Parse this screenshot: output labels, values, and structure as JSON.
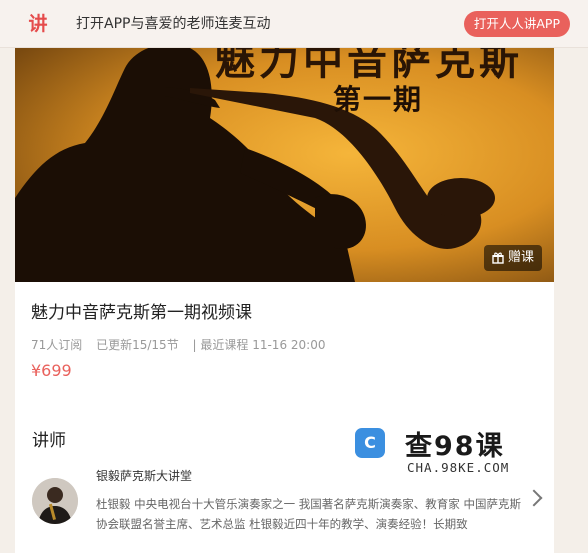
{
  "topbar": {
    "logo_text": "讲",
    "promo_text": "打开APP与喜爱的老师连麦互动",
    "open_app_label": "打开人人讲APP"
  },
  "course": {
    "banner_title_top": "魅力中音萨克斯",
    "banner_title": "第一期",
    "gift_label": "赠课",
    "title": "魅力中音萨克斯第一期视频课",
    "subscribers": "71人订阅",
    "updated": "已更新15/15节",
    "recent_label": "| 最近课程 11-16 20:00",
    "price": "¥699"
  },
  "lecturer": {
    "heading": "讲师",
    "name": "银毅萨克斯大讲堂",
    "description": "杜银毅 中央电视台十大管乐演奏家之一 我国著名萨克斯演奏家、教育家 中国萨克斯协会联盟名誉主席、艺术总监 杜银毅近四十年的教学、演奏经验！长期致"
  },
  "watermark": {
    "icon_text": "C",
    "big_text": "查98课",
    "small_text": "CHA.98KE.COM"
  },
  "colors": {
    "accent": "#e9615c",
    "banner": "#c8821f"
  }
}
